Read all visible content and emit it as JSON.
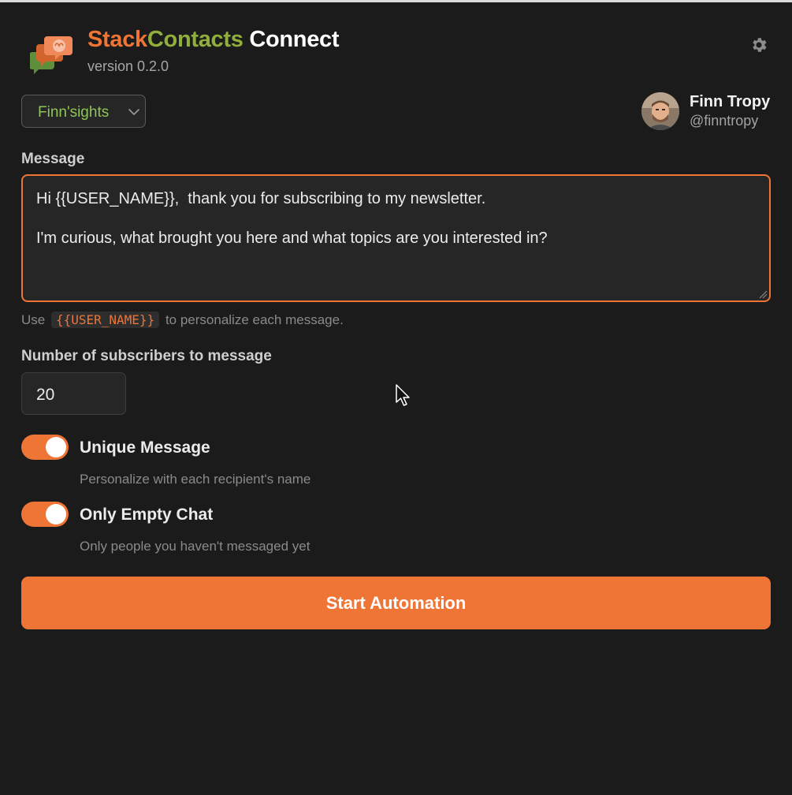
{
  "header": {
    "title_part1": "Stack",
    "title_part2": "Contacts",
    "title_part3": "Connect",
    "version": "version 0.2.0",
    "settings_icon": "gear-icon"
  },
  "workspace": {
    "selected": "Finn'sights"
  },
  "user": {
    "name": "Finn Tropy",
    "handle": "@finntropy"
  },
  "message": {
    "label": "Message",
    "line1": "Hi {{USER_NAME}},  thank you for subscribing to my newsletter.",
    "line2": "I'm curious, what brought you here and what topics are you interested in?",
    "hint_before": "Use",
    "hint_token": "{{USER_NAME}}",
    "hint_after": "to personalize each message."
  },
  "subscribers": {
    "label": "Number of subscribers to message",
    "value": "20"
  },
  "options": [
    {
      "label": "Unique Message",
      "description": "Personalize with each recipient's name",
      "enabled": true
    },
    {
      "label": "Only Empty Chat",
      "description": "Only people you haven't messaged yet",
      "enabled": true
    }
  ],
  "action": {
    "start_label": "Start Automation"
  },
  "colors": {
    "accent": "#ef7537",
    "brand_green": "#8fae3b",
    "background": "#1b1b1b"
  }
}
